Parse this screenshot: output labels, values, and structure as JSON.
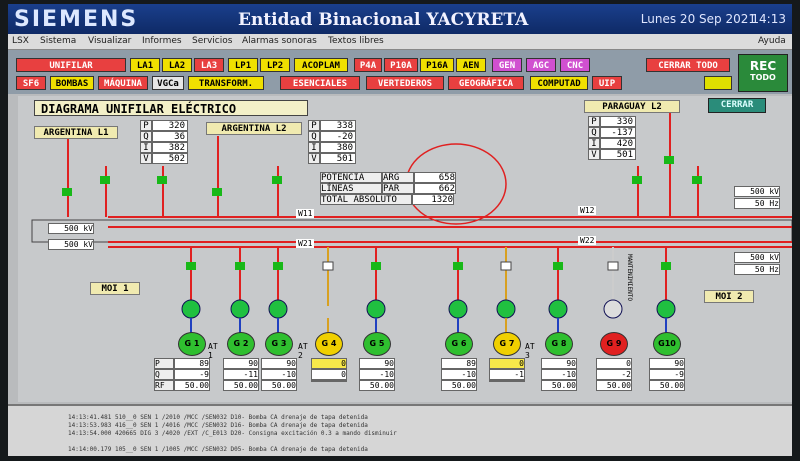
{
  "header": {
    "brand": "SIEMENS",
    "title": "Entidad Binacional YACYRETA",
    "date": "Lunes  20 Sep 2021",
    "time": "14:13"
  },
  "menu": {
    "items": [
      "LSX",
      "Sistema",
      "Visualizar",
      "Informes",
      "Servicios",
      "Alarmas sonoras",
      "Textos libres"
    ],
    "help": "Ayuda"
  },
  "toolbar": {
    "row1": [
      "UNIFILAR",
      "LA1",
      "LA2",
      "LA3",
      "LP1",
      "LP2",
      "ACOPLAM",
      "P4A",
      "P10A",
      "P16A",
      "AEN",
      "GEN",
      "AGC",
      "CNC",
      "CERRAR TODO"
    ],
    "row2": [
      "SF6",
      "BOMBAS",
      "MÁQUINA",
      "VGCa",
      "TRANSFORM.",
      "ESENCIALES",
      "VERTEDEROS",
      "GEOGRÁFICA",
      "COMPUTAD",
      "UIP"
    ],
    "rec": "REC",
    "rec_sub": "TODO"
  },
  "diagram": {
    "title": "DIAGRAMA UNIFILAR ELÉCTRICO",
    "close": "CERRAR",
    "argentina_l1": {
      "label": "ARGENTINA L1",
      "P": "320",
      "Q": "36",
      "I": "382",
      "V": "502"
    },
    "argentina_l2": {
      "label": "ARGENTINA L2",
      "P": "338",
      "Q": "-20",
      "I": "380",
      "V": "501"
    },
    "paraguay_l2": {
      "label": "PARAGUAY  L2",
      "P": "330",
      "Q": "-137",
      "I": "420",
      "V": "501"
    },
    "power": {
      "label": "POTENCIA",
      "lines": "LÍNEAS",
      "total": "TOTAL ABSOLUTO",
      "arg_k": "ARG",
      "par_k": "PAR",
      "arg": "658",
      "par": "662",
      "total_v": "1320"
    },
    "bus": {
      "left1": "500 kV",
      "left2": "500 kV",
      "right1": "500 kV",
      "right2": "50 Hz",
      "right3": "500 kV",
      "right4": "50 Hz",
      "w11": "W11",
      "w12": "W12",
      "w21": "W21",
      "w22": "W22"
    },
    "moi1": "MOI 1",
    "moi2": "MOI 2",
    "generators": [
      {
        "name": "G 1",
        "P": "89",
        "Q": "-9",
        "RF": "50.00",
        "color": "#2fbf2f"
      },
      {
        "name": "G 2",
        "P": "90",
        "Q": "-11",
        "RF": "50.00",
        "color": "#2fbf2f"
      },
      {
        "name": "G 3",
        "P": "90",
        "Q": "-10",
        "RF": "50.00",
        "color": "#2fbf2f"
      },
      {
        "name": "G 4",
        "P": "0",
        "Q": "0",
        "RF": "",
        "color": "#f0d000"
      },
      {
        "name": "G 5",
        "P": "90",
        "Q": "-10",
        "RF": "50.00",
        "color": "#2fbf2f"
      },
      {
        "name": "G 6",
        "P": "89",
        "Q": "-10",
        "RF": "50.00",
        "color": "#2fbf2f"
      },
      {
        "name": "G 7",
        "P": "0",
        "Q": "-1",
        "RF": "",
        "color": "#f0d000"
      },
      {
        "name": "G 8",
        "P": "90",
        "Q": "-10",
        "RF": "50.00",
        "color": "#2fbf2f"
      },
      {
        "name": "G 9",
        "P": "0",
        "Q": "-2",
        "RF": "50.00",
        "color": "#e02020"
      },
      {
        "name": "G10",
        "P": "90",
        "Q": "-9",
        "RF": "50.00",
        "color": "#2fbf2f"
      }
    ],
    "at": [
      "AT 1",
      "AT 2",
      "AT 3"
    ],
    "maint": "MANTENIMIENTO"
  },
  "log": {
    "lines": [
      "14:13:41.481 510__0 SEN    1 /2010  /MCC    /SEN032 D10- Bomba CA drenaje de tapa  detenida",
      "14:13:53.983 416__0 SEN    1 /4016  /MCC    /SEN032 D16- Bomba CA drenaje de tapa  detenida",
      "14:13:54.000 420665 DIG    3 /4020  /EXT    /C_E013 D20- Consigna excitación 0.3 a mando disminuir",
      "14:14:00.179 105__0 SEN    1 /1005  /MCC    /SEN032 D05- Bomba CA drenaje de tapa  detenida"
    ]
  }
}
